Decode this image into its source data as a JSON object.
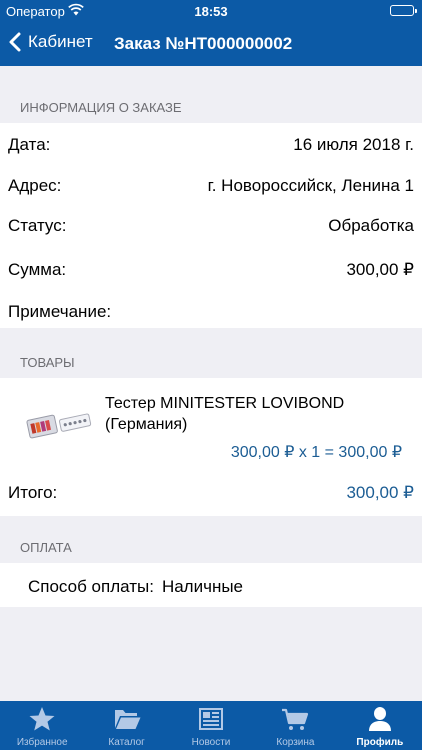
{
  "status_bar": {
    "carrier": "Оператор",
    "time": "18:53"
  },
  "nav": {
    "back_label": "Кабинет",
    "title": "Заказ №НТ000000002"
  },
  "info": {
    "header": "ИНФОРМАЦИЯ О ЗАКАЗЕ",
    "rows": [
      {
        "label": "Дата:",
        "value": "16 июля 2018 г."
      },
      {
        "label": "Адрес:",
        "value": "г. Новороссийск, Ленина 1"
      },
      {
        "label": "Статус:",
        "value": "Обработка"
      },
      {
        "label": "Сумма:",
        "value": "300,00 ₽"
      },
      {
        "label": "Примечание:",
        "value": ""
      }
    ]
  },
  "goods": {
    "header": "ТОВАРЫ",
    "items": [
      {
        "name": "Тестер MINITESTER LOVIBOND (Германия)",
        "price_line": "300,00 ₽ x 1 = 300,00 ₽"
      }
    ],
    "total_label": "Итого:",
    "total_value": "300,00 ₽"
  },
  "payment": {
    "header": "ОПЛАТА",
    "method_label": "Способ оплаты:",
    "method_value": "Наличные"
  },
  "tabs": [
    {
      "label": "Избранное",
      "icon": "star-icon",
      "active": false
    },
    {
      "label": "Каталог",
      "icon": "folder-icon",
      "active": false
    },
    {
      "label": "Новости",
      "icon": "newspaper-icon",
      "active": false
    },
    {
      "label": "Корзина",
      "icon": "cart-icon",
      "active": false
    },
    {
      "label": "Профиль",
      "icon": "person-icon",
      "active": true
    }
  ],
  "colors": {
    "brand": "#0c5aa6",
    "link": "#1c5d94",
    "background": "#efeff4",
    "inactive_tab": "#b3c9e6"
  }
}
